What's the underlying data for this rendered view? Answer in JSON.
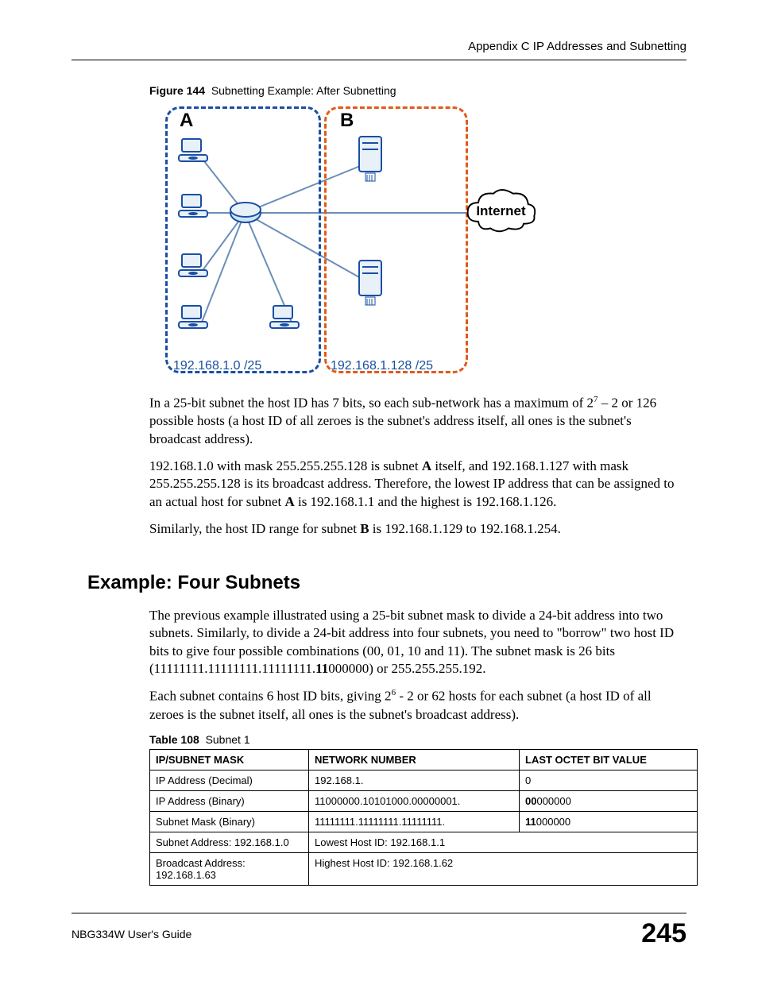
{
  "header": {
    "appendix": "Appendix C IP Addresses and Subnetting"
  },
  "figure": {
    "label": "Figure 144",
    "title": "Subnetting Example: After Subnetting",
    "subnet_a": "A",
    "subnet_b": "B",
    "ip_a": "192.168.1.0 /25",
    "ip_b": "192.168.1.128 /25",
    "internet": "Internet"
  },
  "para1_a": "In a 25-bit subnet the host ID has 7 bits, so each sub-network has a maximum of 2",
  "para1_sup": "7",
  "para1_b": " – 2 or 126 possible hosts (a host ID of all zeroes is the subnet's address itself, all ones is the subnet's broadcast address).",
  "para2_a": "192.168.1.0 with mask 255.255.255.128 is subnet ",
  "para2_bold1": "A",
  "para2_b": " itself, and 192.168.1.127 with mask 255.255.255.128 is its broadcast address. Therefore, the lowest IP address that can be assigned to an actual host for subnet ",
  "para2_bold2": "A",
  "para2_c": " is 192.168.1.1 and the highest is 192.168.1.126.",
  "para3_a": "Similarly, the host ID range for subnet ",
  "para3_bold": "B",
  "para3_b": " is 192.168.1.129 to 192.168.1.254.",
  "section_heading": "Example: Four Subnets",
  "para4_a": "The previous example illustrated using a 25-bit subnet mask to divide a 24-bit address into two subnets. Similarly, to divide a 24-bit address into four subnets, you need to \"borrow\" two host ID bits to give four possible combinations (00, 01, 10 and 11). The subnet mask is 26 bits (11111111.11111111.11111111.",
  "para4_bold": "11",
  "para4_b": "000000) or 255.255.255.192.",
  "para5_a": "Each subnet contains 6 host ID bits, giving 2",
  "para5_sup": "6",
  "para5_b": " - 2 or 62 hosts for each subnet (a host ID of all zeroes is the subnet itself, all ones is the subnet's broadcast address).",
  "table": {
    "label": "Table 108",
    "title": "Subnet 1",
    "headers": {
      "c1": "IP/SUBNET MASK",
      "c2": "NETWORK NUMBER",
      "c3": "LAST OCTET BIT VALUE"
    },
    "rows": [
      {
        "c1": "IP Address (Decimal)",
        "c2": "192.168.1.",
        "c3": "0"
      },
      {
        "c1": "IP Address (Binary)",
        "c2": "11000000.10101000.00000001.",
        "c3_bold": "00",
        "c3_rest": "000000"
      },
      {
        "c1": "Subnet Mask (Binary)",
        "c2": "11111111.11111111.11111111.",
        "c3_bold": "11",
        "c3_rest": "000000"
      },
      {
        "c1": "Subnet Address: 192.168.1.0",
        "c2": "Lowest Host ID: 192.168.1.1"
      },
      {
        "c1": "Broadcast Address: 192.168.1.63",
        "c2": "Highest Host ID: 192.168.1.62"
      }
    ]
  },
  "footer": {
    "guide": "NBG334W User's Guide",
    "page": "245"
  }
}
